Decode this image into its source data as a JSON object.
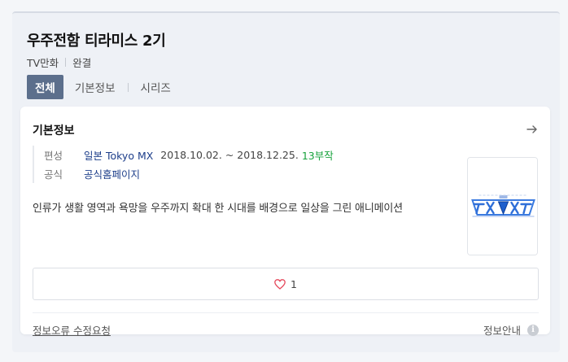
{
  "header": {
    "title": "우주전함 티라미스 2기",
    "meta": [
      "TV만화",
      "완결"
    ]
  },
  "tabs": [
    {
      "label": "전체",
      "active": true
    },
    {
      "label": "기본정보",
      "active": false
    },
    {
      "label": "시리즈",
      "active": false
    }
  ],
  "card": {
    "title": "기본정보",
    "broadcast_label": "편성",
    "broadcast_channel": "일본 Tokyo MX",
    "broadcast_dates": "2018.10.02. ~ 2018.12.25.",
    "episodes": "13부작",
    "official_label": "공식",
    "official_link": "공식홈페이지",
    "description": "인류가 생활 영역과 욕망을 우주까지 확대 한 시대를 배경으로 일상을 그린 애니메이션",
    "like_count": "1",
    "report_link": "정보오류 수정요청",
    "info_guide": "정보안내",
    "info_icon_glyph": "i"
  },
  "colors": {
    "active_tab_bg": "#5c6f8c",
    "link": "#1d3e8a",
    "episodes": "#17a23c",
    "heart": "#e5475a",
    "poster_logo": "#3b7be0"
  }
}
